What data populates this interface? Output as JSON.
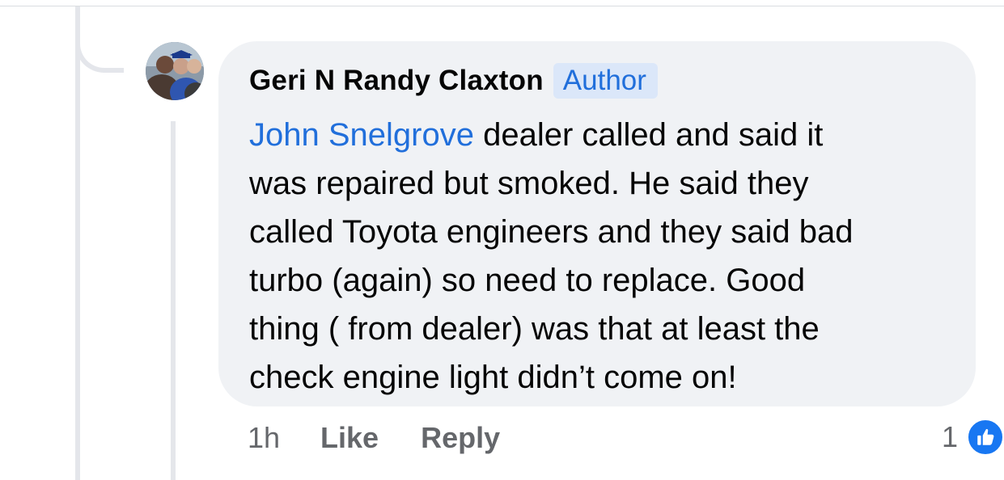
{
  "comment": {
    "author": "Geri N Randy Claxton",
    "badge": "Author",
    "mention": "John Snelgrove",
    "text_lines": [
      " dealer called and said it",
      "was repaired but smoked.   He said they",
      "called Toyota engineers and they said bad",
      "turbo (again) so need to replace.  Good",
      "thing ( from dealer) was that at least the",
      "check engine light didn’t come on!"
    ]
  },
  "actions": {
    "timestamp": "1h",
    "like_label": "Like",
    "reply_label": "Reply"
  },
  "reactions": {
    "count": "1",
    "icon": "thumbs-up-icon",
    "color": "#1877f2"
  },
  "colors": {
    "link": "#216fdb",
    "bubble": "#f0f2f5",
    "badge_bg": "#dbe7f9"
  }
}
